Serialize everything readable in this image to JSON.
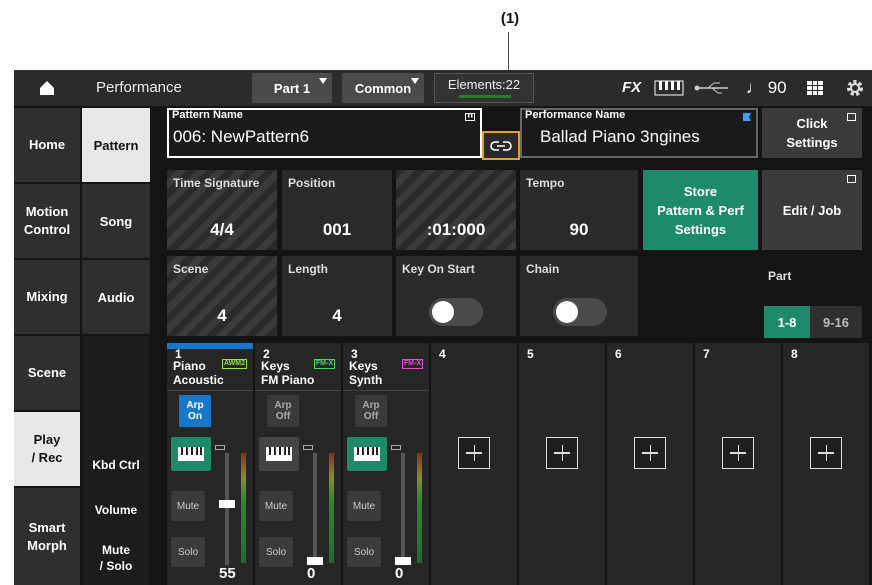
{
  "callout": "(1)",
  "topbar": {
    "title": "Performance",
    "part_dropdown": "Part 1",
    "common_dropdown": "Common",
    "elements": "Elements:22",
    "fx": "FX",
    "tempo": "♩ 90"
  },
  "left_nav": [
    {
      "label": "Home"
    },
    {
      "label": "Motion\nControl"
    },
    {
      "label": "Mixing"
    },
    {
      "label": "Scene"
    },
    {
      "label": "Play\n/ Rec"
    },
    {
      "label": "Smart\nMorph"
    }
  ],
  "sub_nav": [
    {
      "label": "Pattern"
    },
    {
      "label": "Song"
    },
    {
      "label": "Audio"
    }
  ],
  "row_labels": {
    "kbd_ctrl": "Kbd Ctrl",
    "volume": "Volume",
    "mute_solo": "Mute\n/ Solo"
  },
  "pattern_name": {
    "label": "Pattern Name",
    "value": "006: NewPattern6"
  },
  "performance_name": {
    "label": "Performance Name",
    "value": "Ballad Piano 3ngines"
  },
  "click_settings": "Click\nSettings",
  "time_signature": {
    "label": "Time Signature",
    "value": "4/4"
  },
  "position": {
    "label": "Position",
    "measure": "001",
    "beat": ":01:000"
  },
  "tempo": {
    "label": "Tempo",
    "value": "90"
  },
  "store": "Store\nPattern & Perf\nSettings",
  "edit_job": "Edit / Job",
  "scene": {
    "label": "Scene",
    "value": "4"
  },
  "length": {
    "label": "Length",
    "value": "4"
  },
  "key_on_start": {
    "label": "Key On Start"
  },
  "chain": {
    "label": "Chain"
  },
  "part_select": {
    "label": "Part",
    "opt1": "1-8",
    "opt2": "9-16"
  },
  "parts": [
    {
      "num": "1",
      "line1": "Piano",
      "line2": "Acoustic",
      "badge": "AWM2",
      "badge_color": "#9be23c",
      "arp": "Arp\nOn",
      "mute": "Mute",
      "solo": "Solo",
      "volume": "55",
      "level": 0.55
    },
    {
      "num": "2",
      "line1": "Keys",
      "line2": "FM Piano",
      "badge": "FM-X",
      "badge_color": "#48d46a",
      "arp": "Arp\nOff",
      "mute": "Mute",
      "solo": "Solo",
      "volume": "0",
      "level": 0
    },
    {
      "num": "3",
      "line1": "Keys",
      "line2": "Synth",
      "badge": "FM-X",
      "badge_color": "#e44cd7",
      "arp": "Arp\nOff",
      "mute": "Mute",
      "solo": "Solo",
      "volume": "0",
      "level": 0
    },
    {
      "num": "4"
    },
    {
      "num": "5"
    },
    {
      "num": "6"
    },
    {
      "num": "7"
    },
    {
      "num": "8"
    }
  ],
  "colors": {
    "accent": "#1e8a6c",
    "highlight": "#e8a020",
    "part1_strip": "#1778c9"
  }
}
